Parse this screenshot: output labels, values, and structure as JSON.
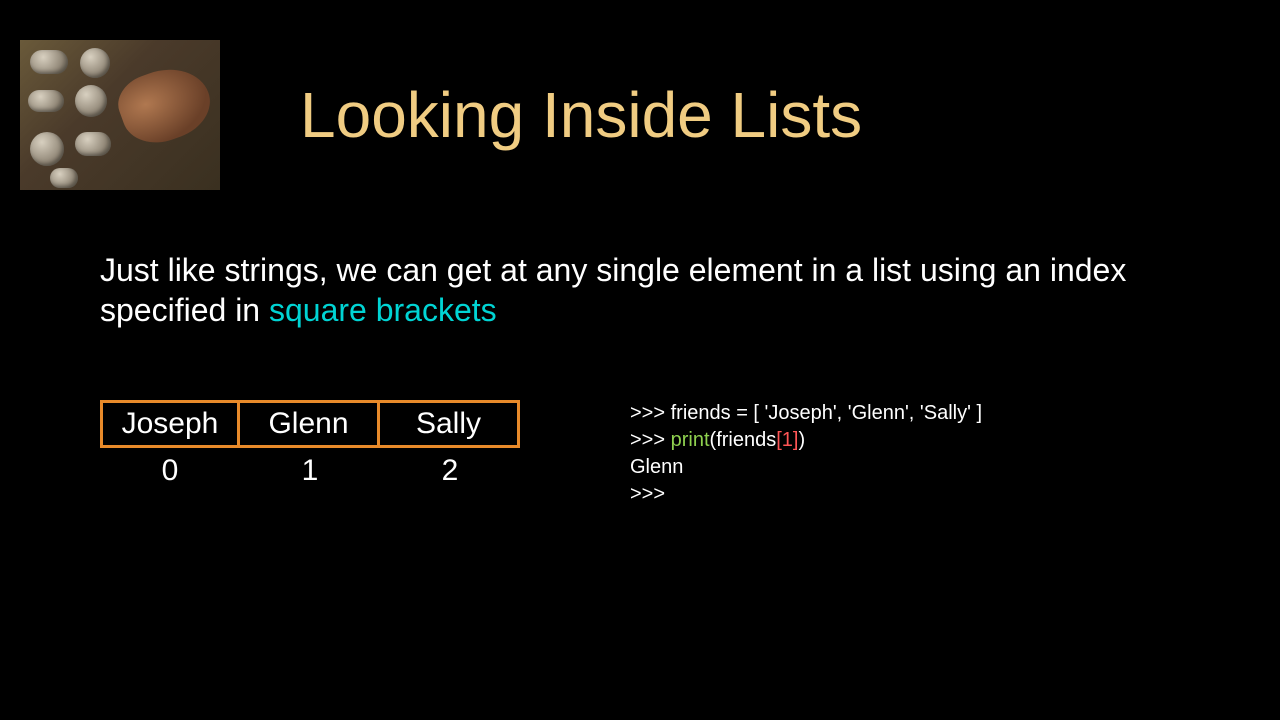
{
  "title": "Looking Inside Lists",
  "body": {
    "pre": "Just like strings, we can get at any single element in a list using an index specified in ",
    "highlight": "square brackets"
  },
  "list": {
    "cells": [
      "Joseph",
      "Glenn",
      "Sally"
    ],
    "indices": [
      "0",
      "1",
      "2"
    ]
  },
  "code": {
    "line1_prompt": ">>> ",
    "line1_rest": "friends = [ 'Joseph', 'Glenn', 'Sally' ]",
    "line2_prompt": ">>> ",
    "line2_fn": "print",
    "line2_open": "(",
    "line2_var": "friends",
    "line2_lb": "[",
    "line2_num": "1",
    "line2_rb": "]",
    "line2_close": ")",
    "line3": "Glenn",
    "line4": ">>>"
  }
}
